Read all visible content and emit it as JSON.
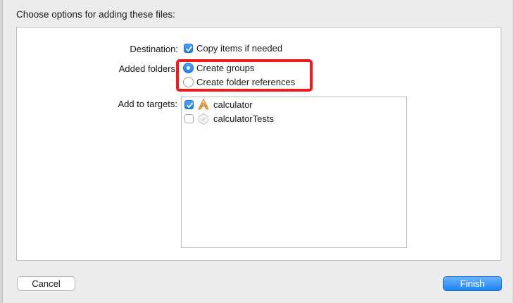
{
  "dialog": {
    "prompt": "Choose options for adding these files:"
  },
  "destination": {
    "label": "Destination:",
    "option_label": "Copy items if needed",
    "checked": true
  },
  "added_folders": {
    "label": "Added folders",
    "options": [
      {
        "label": "Create groups",
        "selected": true
      },
      {
        "label": "Create folder references",
        "selected": false
      }
    ]
  },
  "targets": {
    "label": "Add to targets:",
    "items": [
      {
        "name": "calculator",
        "checked": true,
        "icon": "app-target-icon"
      },
      {
        "name": "calculatorTests",
        "checked": false,
        "icon": "test-target-icon"
      }
    ]
  },
  "buttons": {
    "cancel": "Cancel",
    "finish": "Finish"
  },
  "colors": {
    "accent": "#1c7ff2",
    "highlight": "#ee1c1c"
  }
}
